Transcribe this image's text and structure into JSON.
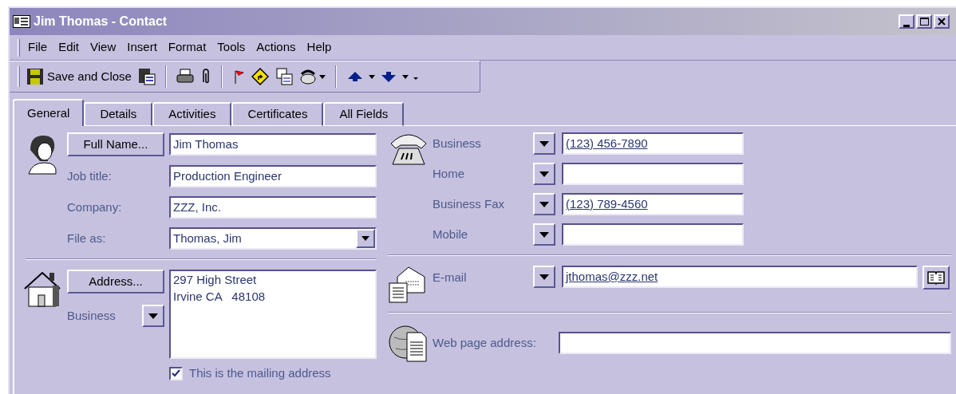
{
  "window": {
    "title": "Jim Thomas - Contact"
  },
  "menu": [
    "File",
    "Edit",
    "View",
    "Insert",
    "Format",
    "Tools",
    "Actions",
    "Help"
  ],
  "toolbar": {
    "save_label": "Save and Close"
  },
  "tabs": [
    {
      "label": "General",
      "selected": true
    },
    {
      "label": "Details",
      "selected": false
    },
    {
      "label": "Activities",
      "selected": false
    },
    {
      "label": "Certificates",
      "selected": false
    },
    {
      "label": "All Fields",
      "selected": false
    }
  ],
  "name_fields": [
    {
      "kind": "button",
      "label": "Full Name...",
      "value": "Jim Thomas"
    },
    {
      "kind": "label",
      "label": "Job title:",
      "value": "Production Engineer"
    },
    {
      "kind": "label",
      "label": "Company:",
      "value": "ZZZ, Inc."
    },
    {
      "kind": "combo",
      "label": "File as:",
      "value": "Thomas, Jim"
    }
  ],
  "address": {
    "button": "Address...",
    "type": "Business",
    "lines": [
      "297 High Street",
      "Irvine CA   48108"
    ],
    "mailing": {
      "label": "This is the mailing address",
      "checked": true
    }
  },
  "phones": [
    {
      "label": "Business",
      "value": "(123) 456-7890"
    },
    {
      "label": "Home"
    },
    {
      "label": "Business Fax",
      "value": "(123) 789-4560"
    },
    {
      "label": "Mobile"
    }
  ],
  "email": {
    "label": "E-mail",
    "value": "jthomas@zzz.net"
  },
  "web": {
    "label": "Web page address:"
  }
}
